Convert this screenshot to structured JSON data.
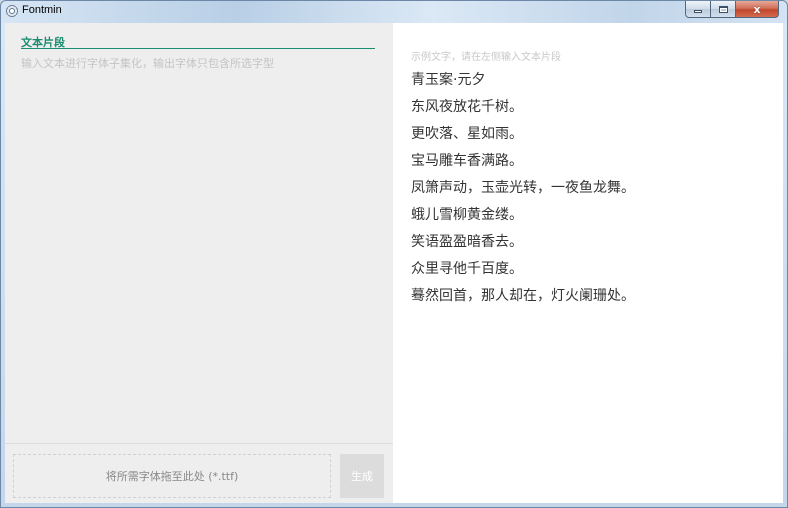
{
  "window": {
    "title": "Fontmin",
    "controls": {
      "minimize": "–",
      "maximize": "□",
      "close": "x"
    }
  },
  "left_panel": {
    "tab_label": "文本片段",
    "input_placeholder": "输入文本进行字体子集化，输出字体只包含所选字型",
    "input_value": ""
  },
  "bottom_bar": {
    "drop_zone_text": "将所需字体拖至此处 (*.ttf)",
    "generate_label": "生成"
  },
  "right_panel": {
    "hint": "示例文字，请在左侧输入文本片段",
    "lines": [
      "青玉案·元夕",
      "东风夜放花千树。",
      "更吹落、星如雨。",
      "宝马雕车香满路。",
      "凤箫声动，玉壶光转，一夜鱼龙舞。",
      "蛾儿雪柳黄金缕。",
      "笑语盈盈暗香去。",
      "众里寻他千百度。",
      "蓦然回首，那人却在，灯火阑珊处。"
    ]
  }
}
